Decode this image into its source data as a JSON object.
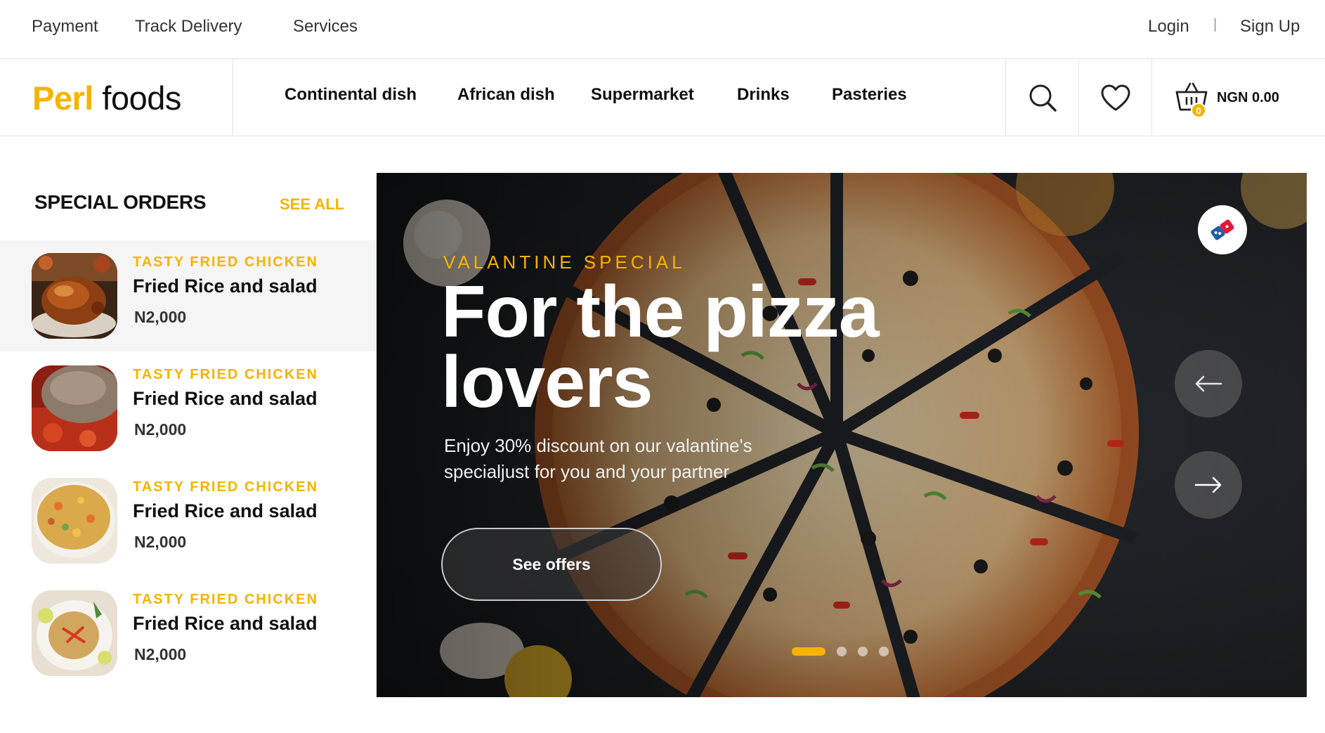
{
  "topbar": {
    "links": [
      "Payment",
      "Track Delivery",
      "Services"
    ],
    "login": "Login",
    "separator": "|",
    "signup": "Sign Up"
  },
  "logo": {
    "part1": "Perl",
    "part2": "foods"
  },
  "nav": {
    "items": [
      "Continental dish",
      "African dish",
      "Supermarket",
      "Drinks",
      "Pasteries"
    ]
  },
  "cart": {
    "count": "0",
    "total": "NGN 0.00"
  },
  "special_orders": {
    "heading": "SPECIAL ORDERS",
    "see_all": "SEE ALL",
    "items": [
      {
        "tag": "TASTY FRIED CHICKEN",
        "name": "Fried Rice and salad",
        "price": "N2,000"
      },
      {
        "tag": "TASTY FRIED CHICKEN",
        "name": "Fried Rice and salad",
        "price": "N2,000"
      },
      {
        "tag": "TASTY FRIED CHICKEN",
        "name": "Fried Rice and salad",
        "price": "N2,000"
      },
      {
        "tag": "TASTY FRIED CHICKEN",
        "name": "Fried Rice and salad",
        "price": "N2,000"
      }
    ]
  },
  "hero": {
    "eyebrow": "VALANTINE SPECIAL",
    "title": "For the pizza lovers",
    "description": "Enjoy 30% discount on our valantine's specialjust for you and your partner",
    "cta": "See offers",
    "active_slide": 1,
    "slide_count": 4
  },
  "colors": {
    "accent": "#f6b300",
    "text": "#111111",
    "hero_bg": "#22252a"
  }
}
